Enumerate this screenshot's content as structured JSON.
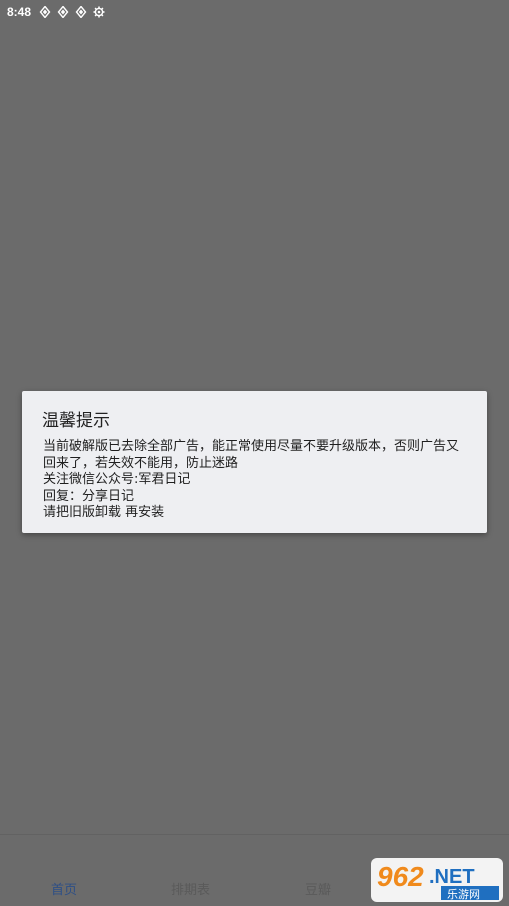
{
  "status_bar": {
    "time": "8:48",
    "icons": [
      "app-icon",
      "app-icon",
      "app-icon",
      "settings-icon"
    ]
  },
  "dialog": {
    "title": "温馨提示",
    "body": "当前破解版已去除全部广告，能正常使用尽量不要升级版本，否则广告又回来了，若失效不能用，防止迷路\n关注微信公众号:军君日记\n回复：分享日记\n请把旧版卸载 再安装"
  },
  "bottom_nav": {
    "items": [
      {
        "label": "首页",
        "active": true
      },
      {
        "label": "排期表",
        "active": false
      },
      {
        "label": "豆瓣",
        "active": false
      }
    ]
  },
  "watermark": {
    "brand": "962.NET",
    "subtitle": "乐游网"
  },
  "colors": {
    "background": "#6b6b6b",
    "dialog_bg": "#eeeff2",
    "nav_active": "#2e4f86",
    "watermark_orange": "#f08a1c",
    "watermark_blue": "#1f6fc0"
  }
}
